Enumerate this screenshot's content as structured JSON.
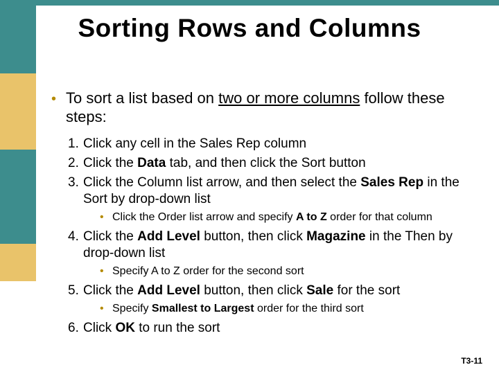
{
  "title": "Sorting Rows and Columns",
  "lead": {
    "pre": "To sort a list based on ",
    "underlined": "two or more columns",
    "post": " follow these steps:"
  },
  "steps": {
    "s1": {
      "num": "1.",
      "text": "Click any cell in the Sales Rep column"
    },
    "s2": {
      "num": "2.",
      "pre": "Click the ",
      "b1": "Data",
      "post": " tab, and then click the Sort button"
    },
    "s3": {
      "num": "3.",
      "pre": "Click the Column list arrow, and then select the ",
      "b1": "Sales Rep",
      "post": " in the Sort by drop-down list",
      "sub": {
        "pre": "Click the Order list arrow and specify ",
        "b1": "A to Z",
        "post": " order for that column"
      }
    },
    "s4": {
      "num": "4.",
      "pre": "Click the ",
      "b1": "Add Level",
      "mid": " button, then click ",
      "b2": "Magazine",
      "post": " in the Then by drop-down list",
      "sub": {
        "text": "Specify A to Z order for the second sort"
      }
    },
    "s5": {
      "num": "5.",
      "pre": "Click the ",
      "b1": "Add Level",
      "mid": " button, then click ",
      "b2": "Sale",
      "post": " for the sort",
      "sub": {
        "pre": "Specify ",
        "b1": "Smallest to Largest",
        "post": " order for the third sort"
      }
    },
    "s6": {
      "num": "6.",
      "pre": "Click ",
      "b1": "OK",
      "post": " to run the sort"
    }
  },
  "footer": "T3-11"
}
